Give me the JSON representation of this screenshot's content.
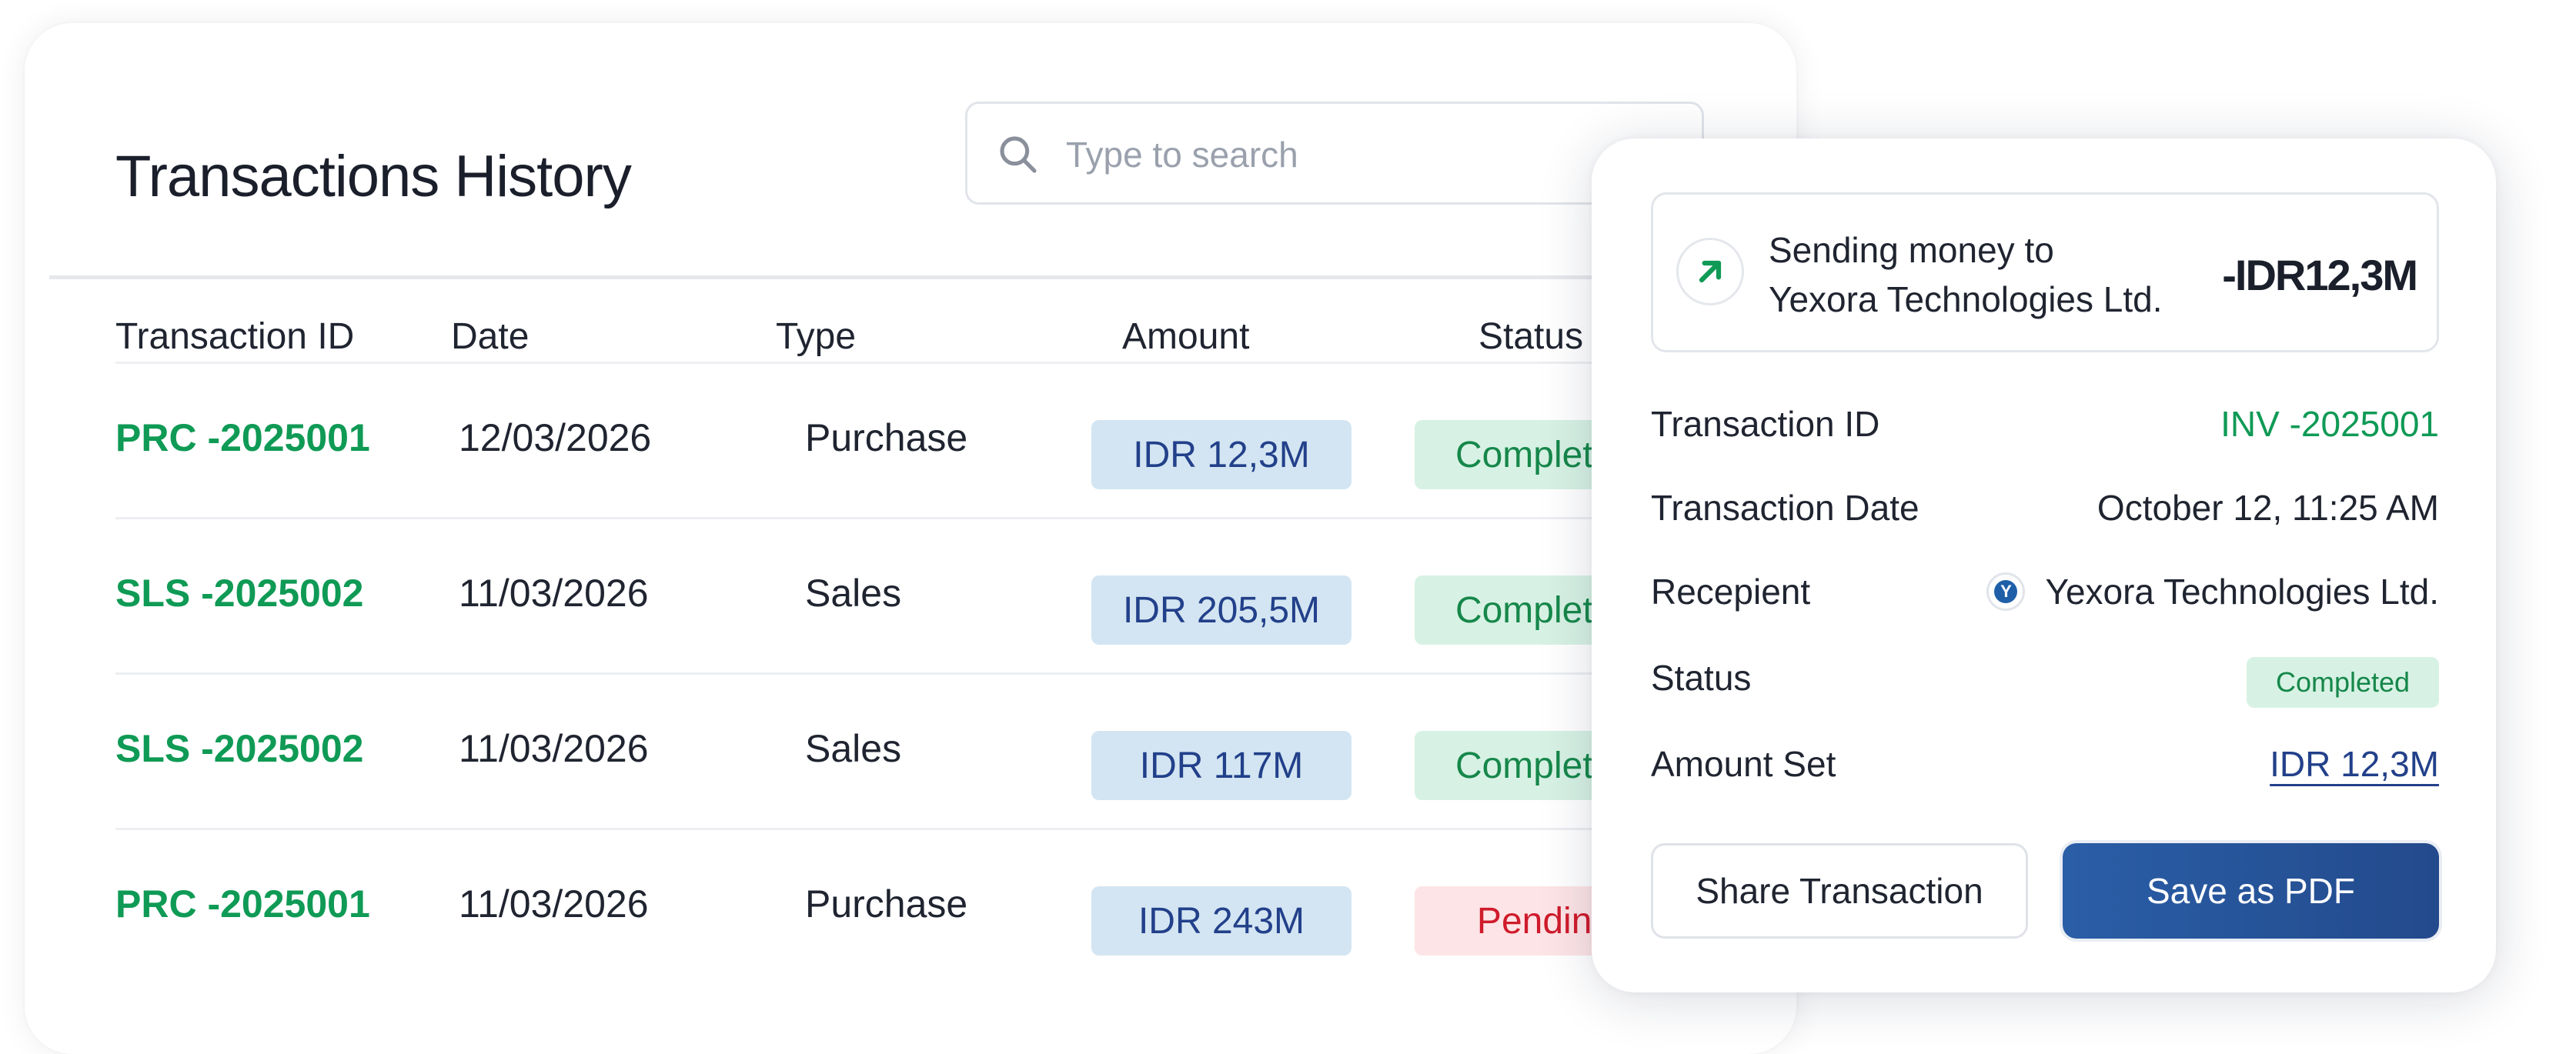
{
  "header": {
    "title": "Transactions History",
    "search_placeholder": "Type to search"
  },
  "table": {
    "columns": [
      "Transaction ID",
      "Date",
      "Type",
      "Amount",
      "Status"
    ],
    "rows": [
      {
        "id": "PRC -2025001",
        "date": "12/03/2026",
        "type": "Purchase",
        "amount": "IDR 12,3M",
        "status": "Completed"
      },
      {
        "id": "SLS -2025002",
        "date": "11/03/2026",
        "type": "Sales",
        "amount": "IDR 205,5M",
        "status": "Completed"
      },
      {
        "id": "SLS -2025002",
        "date": "11/03/2026",
        "type": "Sales",
        "amount": "IDR 117M",
        "status": "Completed"
      },
      {
        "id": "PRC -2025001",
        "date": "11/03/2026",
        "type": "Purchase",
        "amount": "IDR 243M",
        "status": "Pending"
      }
    ]
  },
  "detail": {
    "summary": {
      "line1": "Sending money to",
      "line2": "Yexora Technologies Ltd.",
      "amount": "-IDR12,3M"
    },
    "fields": {
      "transaction_id_label": "Transaction ID",
      "transaction_id_value": "INV -2025001",
      "date_label": "Transaction Date",
      "date_value": "October 12, 11:25 AM",
      "recipient_label": "Recepient",
      "recipient_value": "Yexora Technologies Ltd.",
      "status_label": "Status",
      "status_value": "Completed",
      "amount_label": "Amount Set",
      "amount_value": "IDR 12,3M"
    },
    "buttons": {
      "share": "Share Transaction",
      "pdf": "Save as PDF"
    }
  },
  "colors": {
    "accent_green": "#0f9a55",
    "amount_pill_bg": "#d3e5f2",
    "completed_bg": "#d7f2e4",
    "pending_bg": "#fde4e6",
    "primary_blue": "#2a5ea7"
  }
}
